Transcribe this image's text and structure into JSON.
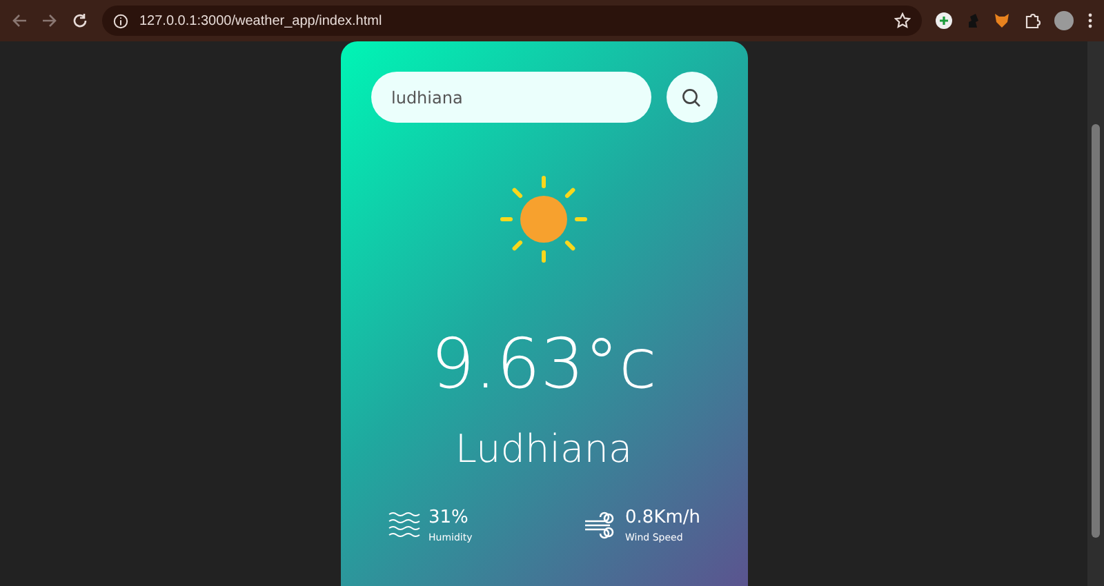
{
  "browser": {
    "url": "127.0.0.1:3000/weather_app/index.html"
  },
  "search": {
    "value": "ludhiana"
  },
  "weather": {
    "temperature": "9.63°c",
    "city": "Ludhiana"
  },
  "details": [
    {
      "kind": "humidity",
      "value": "31%",
      "label": "Humidity"
    },
    {
      "kind": "wind",
      "value": "0.8Km/h",
      "label": "Wind Speed"
    }
  ]
}
